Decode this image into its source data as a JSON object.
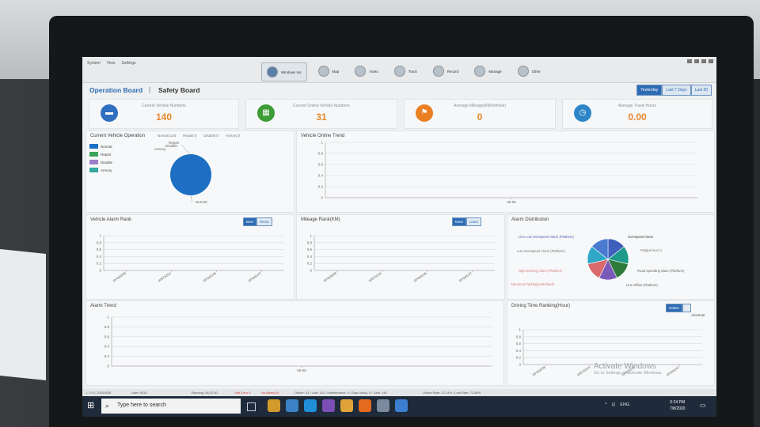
{
  "menu": [
    "System",
    "View",
    "Settings"
  ],
  "nav": [
    {
      "label": "Windows Ios"
    },
    {
      "label": "Map"
    },
    {
      "label": "Video"
    },
    {
      "label": "Track"
    },
    {
      "label": "Record"
    },
    {
      "label": "Manage"
    },
    {
      "label": "Other"
    }
  ],
  "tabs": {
    "operation": "Operation Board",
    "separator": "|",
    "safety": "Safety Board"
  },
  "ranges": [
    "Yesterday",
    "Last 7 Days",
    "Last 30"
  ],
  "kpis": [
    {
      "label": "Current Vehicle Numbers",
      "value": "140",
      "color": "#2e6fbf",
      "icon": "car-icon"
    },
    {
      "label": "Current Online Vehicle Numbers",
      "value": "31",
      "color": "#3e9c35",
      "icon": "calendar-icon"
    },
    {
      "label": "Average Mileage(KM/Vehicle)",
      "value": "0",
      "color": "#ea7f23",
      "icon": "flag-icon"
    },
    {
      "label": "Average Travel Hours",
      "value": "0.00",
      "color": "#2e86c8",
      "icon": "clock-icon"
    }
  ],
  "operation": {
    "title": "Current Vehicle Operation",
    "stats": [
      "Normal:140",
      "Repair:0",
      "Disable:0",
      "Armory:0"
    ],
    "legend": [
      {
        "label": "Normal",
        "color": "#1d6fc4"
      },
      {
        "label": "Repair",
        "color": "#3aa55a"
      },
      {
        "label": "Disable",
        "color": "#9d7ecb"
      },
      {
        "label": "Armory",
        "color": "#33a8a0"
      }
    ],
    "pie_labels": [
      "Repair",
      "Disable",
      "Armory",
      "Normal"
    ]
  },
  "online_trend": {
    "title": "Vehicle Online Trend",
    "yticks": [
      "1",
      "0.8",
      "0.6",
      "0.4",
      "0.2",
      "0"
    ],
    "xtick": "06-05"
  },
  "alarm_rank": {
    "title": "Vehicle Alarm Rank",
    "best": "Best",
    "worst": "Worst",
    "yticks": [
      "1",
      "0.8",
      "0.6",
      "0.4",
      "0.2",
      "0"
    ],
    "xticks": [
      "BPW0608",
      "WB7626A",
      "BPW0196",
      "BPW0247"
    ]
  },
  "mileage_rank": {
    "title": "Mileage Rank(KM)",
    "most": "Most",
    "least": "Least",
    "yticks": [
      "1",
      "0.8",
      "0.6",
      "0.4",
      "0.2",
      "0"
    ],
    "xticks": [
      "BPW0608",
      "WB7626A",
      "BPW0196",
      "BPW0247"
    ]
  },
  "alarm_dist": {
    "title": "Alarm Distribution",
    "labels": [
      {
        "text": "Line Low Overspeed Alarm (Platform)",
        "color": "#4a5fb0"
      },
      {
        "text": "Overspeed Alarm",
        "color": "#3a3a3a"
      },
      {
        "text": "Low Overspeed Alarm (Platform)",
        "color": "#777777"
      },
      {
        "text": "Fatigue level 1",
        "color": "#777777"
      },
      {
        "text": "Night Driving Alarm (Platform)",
        "color": "#d77c7c"
      },
      {
        "text": "Road Speeding Warn (Platform)",
        "color": "#666666"
      },
      {
        "text": "Abnormal Parking(Undefined)",
        "color": "#d77c7c"
      },
      {
        "text": "Line Offset (Platform)",
        "color": "#666666"
      }
    ],
    "slices": [
      "#3e5fbc",
      "#1e9a8a",
      "#2e7a3a",
      "#7a5ab8",
      "#d9696a",
      "#2fa8c8",
      "#4a7ad0"
    ]
  },
  "alarm_trend": {
    "title": "Alarm Trend",
    "yticks": [
      "1",
      "0.8",
      "0.6",
      "0.4",
      "0.2",
      "0"
    ],
    "xtick": "06-05"
  },
  "driving_rank": {
    "title": "Driving Time Ranking(Hour)",
    "online": "Online",
    "other": "",
    "subtitle": "Absolute",
    "yticks": [
      "1",
      "0.8",
      "0.6",
      "0.4",
      "0.2",
      "0"
    ],
    "xticks": [
      "BPW0608",
      "WB7626A",
      "BPW0196",
      "BPW0247"
    ]
  },
  "statusbar": {
    "version": "1.7.0.0_20200528",
    "user": "User: 5015",
    "running": "Running: 08:22:30",
    "alarm1": "Unit Error 0",
    "alarm2": "No Alarm(.0)",
    "counts": "Online: 31 / Lost: 101 / Maintenance: 0 / Stop Using: 0 / Total: 140",
    "rate": "Online Rate: 22.14% / Lost Rate: 72.86%"
  },
  "watermark": {
    "line1": "Activate Windows",
    "line2": "Go to Settings to activate Windows."
  },
  "taskbar": {
    "search_placeholder": "Type here to search",
    "apps": [
      "#d19a2b",
      "#3b82c4",
      "#1f8fd8",
      "#7b4fb5",
      "#e2a23a",
      "#e46a1f",
      "#7c8aa0",
      "#3c7fd0"
    ],
    "tray": [
      "^",
      "⊡",
      "ENG"
    ],
    "time": "6:24 PM",
    "date": "7/8/2020"
  }
}
